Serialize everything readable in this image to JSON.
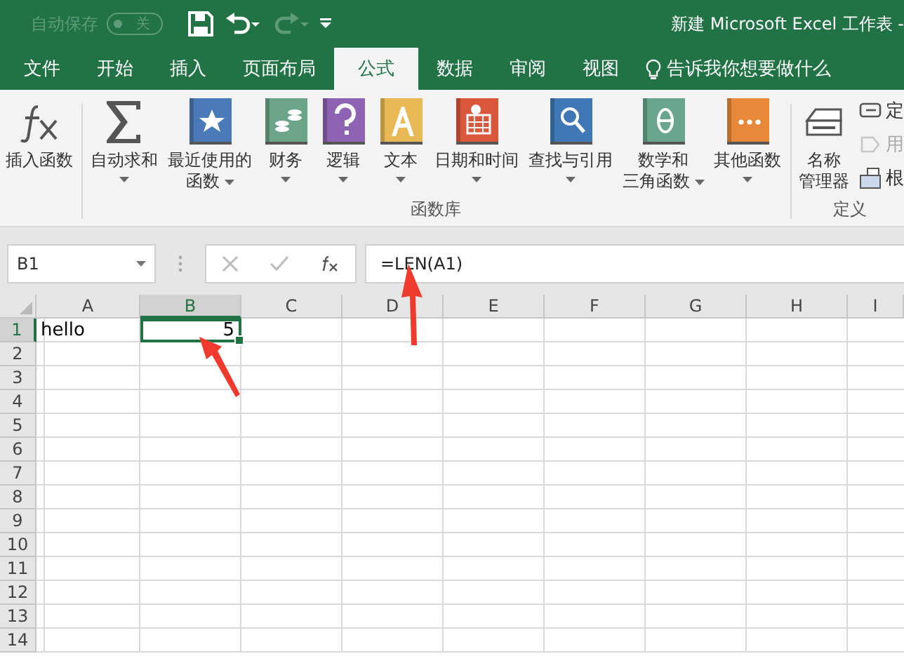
{
  "title_bar": {
    "autosave": {
      "label": "自动保存",
      "on": false,
      "state_text": "关"
    },
    "title": "新建 Microsoft Excel 工作表 -"
  },
  "tabs": [
    {
      "label": "文件",
      "selected": false
    },
    {
      "label": "开始",
      "selected": false
    },
    {
      "label": "插入",
      "selected": false
    },
    {
      "label": "页面布局",
      "selected": false
    },
    {
      "label": "公式",
      "selected": true
    },
    {
      "label": "数据",
      "selected": false
    },
    {
      "label": "审阅",
      "selected": false
    },
    {
      "label": "视图",
      "selected": false
    }
  ],
  "tell_me": {
    "placeholder": "告诉我你想要做什么"
  },
  "ribbon": {
    "insert_function": {
      "label": "插入函数"
    },
    "function_library": {
      "label": "函数库",
      "buttons": [
        {
          "lines": [
            "自动求和"
          ],
          "dropdown": true
        },
        {
          "lines": [
            "最近使用的",
            "函数"
          ],
          "dropdown": true
        },
        {
          "lines": [
            "财务"
          ],
          "dropdown": true
        },
        {
          "lines": [
            "逻辑"
          ],
          "dropdown": true
        },
        {
          "lines": [
            "文本"
          ],
          "dropdown": true
        },
        {
          "lines": [
            "日期和时间"
          ],
          "dropdown": true
        },
        {
          "lines": [
            "查找与引用"
          ],
          "dropdown": true
        },
        {
          "lines": [
            "数学和",
            "三角函数"
          ],
          "dropdown": true
        },
        {
          "lines": [
            "其他函数"
          ],
          "dropdown": true
        }
      ]
    },
    "defined_names": {
      "label": "定义",
      "name_manager": [
        "名称",
        "管理器"
      ],
      "items": [
        {
          "label": "定",
          "disabled": false
        },
        {
          "label": "用",
          "disabled": true
        },
        {
          "label": "根",
          "disabled": false
        }
      ]
    }
  },
  "formula_bar": {
    "name_box": "B1",
    "formula": "=LEN(A1)"
  },
  "sheet": {
    "columns": [
      {
        "label": "A",
        "selected": false
      },
      {
        "label": "B",
        "selected": true
      },
      {
        "label": "C",
        "selected": false
      },
      {
        "label": "D",
        "selected": false
      },
      {
        "label": "E",
        "selected": false
      },
      {
        "label": "F",
        "selected": false
      },
      {
        "label": "G",
        "selected": false
      },
      {
        "label": "H",
        "selected": false
      },
      {
        "label": "I",
        "selected": false
      }
    ],
    "rows": [
      {
        "label": "1",
        "selected": true,
        "cells": [
          {
            "text": "hello",
            "kind": "text",
            "selected": false
          },
          {
            "text": "5",
            "kind": "number",
            "selected": true
          }
        ]
      },
      {
        "label": "2",
        "selected": false
      },
      {
        "label": "3",
        "selected": false
      },
      {
        "label": "4",
        "selected": false
      },
      {
        "label": "5",
        "selected": false
      },
      {
        "label": "6",
        "selected": false
      },
      {
        "label": "7",
        "selected": false
      },
      {
        "label": "8",
        "selected": false
      },
      {
        "label": "9",
        "selected": false
      },
      {
        "label": "10",
        "selected": false
      },
      {
        "label": "11",
        "selected": false
      },
      {
        "label": "12",
        "selected": false
      },
      {
        "label": "13",
        "selected": false
      },
      {
        "label": "14",
        "selected": false
      }
    ]
  }
}
